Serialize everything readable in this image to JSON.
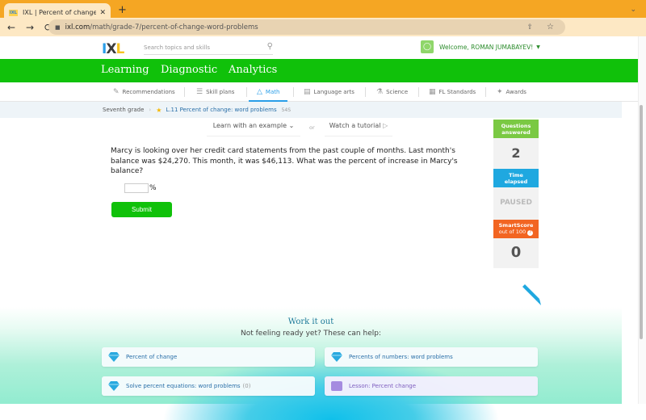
{
  "browser": {
    "tab_title": "IXL | Percent of change: word",
    "tab_favicon_text": "IXL",
    "url_domain": "ixl.com",
    "url_path": "/math/grade-7/percent-of-change-word-problems",
    "icons": {
      "back": "←",
      "forward": "→",
      "reload": "⟳",
      "lock": "🔒",
      "share": "⇧",
      "star": "☆",
      "new_tab": "+",
      "close": "✕",
      "tab_menu": "⌄",
      "profile": "●",
      "menu": "⋮"
    }
  },
  "header": {
    "logo": {
      "i": "I",
      "x": "X",
      "l": "L"
    },
    "search_placeholder": "Search topics and skills",
    "welcome_text": "Welcome, ROMAN JUMABAYEV!"
  },
  "main_nav": [
    {
      "label": "Learning",
      "active": true
    },
    {
      "label": "Diagnostic",
      "active": false
    },
    {
      "label": "Analytics",
      "active": false
    }
  ],
  "sub_nav": [
    {
      "label": "Recommendations",
      "icon": "recommendations-icon"
    },
    {
      "label": "Skill plans",
      "icon": "skill-plans-icon"
    },
    {
      "label": "Math",
      "icon": "math-icon",
      "active": true
    },
    {
      "label": "Language arts",
      "icon": "language-arts-icon"
    },
    {
      "label": "Science",
      "icon": "science-icon"
    },
    {
      "label": "FL Standards",
      "icon": "standards-icon"
    },
    {
      "label": "Awards",
      "icon": "awards-icon"
    }
  ],
  "breadcrumb": {
    "grade": "Seventh grade",
    "skill_code": "L.11",
    "skill_name": "Percent of change: word problems",
    "skill_id": "54S"
  },
  "help": {
    "learn_label": "Learn with an example",
    "or_label": "or",
    "tutorial_label": "Watch a tutorial"
  },
  "question": {
    "text": "Marcy is looking over her credit card statements from the past couple of months. Last month's balance was $24,270. This month, it was $46,113. What was the percent of increase in Marcy's balance?",
    "answer_value": "",
    "unit": "%",
    "submit_label": "Submit"
  },
  "stats": {
    "questions_label_1": "Questions",
    "questions_label_2": "answered",
    "questions_value": "2",
    "time_label_1": "Time",
    "time_label_2": "elapsed",
    "time_value": "PAUSED",
    "score_label_1": "SmartScore",
    "score_label_2": "out of 100",
    "score_value": "0",
    "colors": {
      "questions": "#7ac943",
      "time": "#1fa8e0",
      "score": "#f26522"
    }
  },
  "work_it_out": {
    "title": "Work it out",
    "subtitle": "Not feeling ready yet? These can help:",
    "cards": [
      {
        "label": "Percent of change",
        "type": "skill"
      },
      {
        "label": "Percents of numbers: word problems",
        "type": "skill"
      },
      {
        "label": "Solve percent equations: word problems",
        "count": "(0)",
        "type": "skill"
      },
      {
        "label": "Lesson: Percent change",
        "type": "lesson"
      }
    ]
  }
}
